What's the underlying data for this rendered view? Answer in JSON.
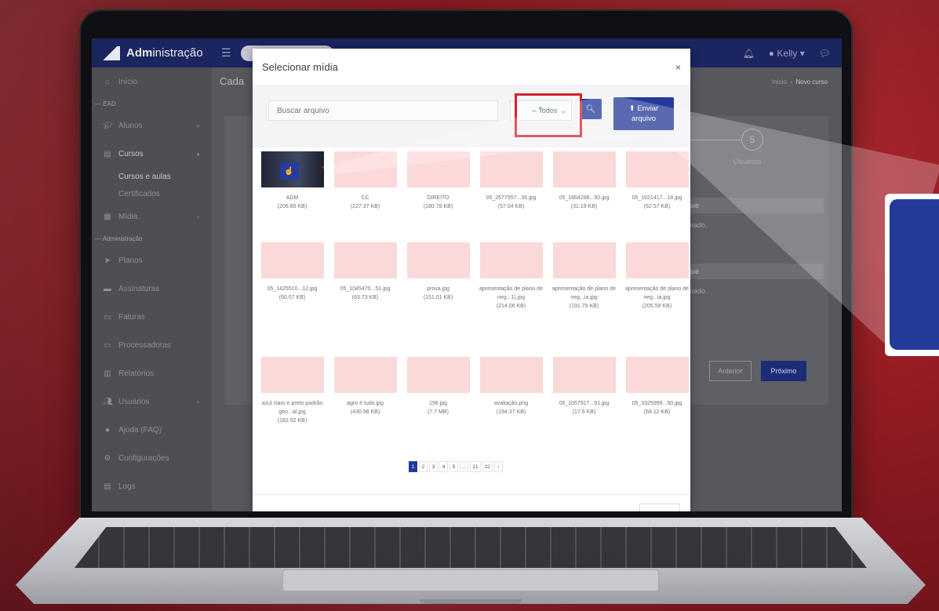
{
  "app": {
    "brand_bold": "Adm",
    "brand_rest": "inistração",
    "user_label": "Kelly"
  },
  "sidebar": {
    "items": [
      {
        "label": "Início",
        "icon": "home-icon"
      },
      {
        "section": "EAD"
      },
      {
        "label": "Alunos",
        "icon": "graduation-cap-icon",
        "chevron": true
      },
      {
        "label": "Cursos",
        "icon": "book-icon",
        "chevron": true,
        "active": true
      },
      {
        "sub": "Cursos e aulas",
        "active": true
      },
      {
        "sub": "Certificados"
      },
      {
        "label": "Mídia",
        "icon": "images-icon",
        "chevron": true
      },
      {
        "section": "Administração"
      },
      {
        "label": "Planos",
        "icon": "send-icon"
      },
      {
        "label": "Assinaturas",
        "icon": "wallet-icon"
      },
      {
        "label": "Faturas",
        "icon": "invoice-icon"
      },
      {
        "label": "Processadoras",
        "icon": "credit-card-icon"
      },
      {
        "label": "Relatórios",
        "icon": "chart-icon"
      },
      {
        "label": "Usuários",
        "icon": "users-icon",
        "chevron": true
      },
      {
        "label": "Ajuda (FAQ)",
        "icon": "help-icon"
      },
      {
        "label": "Configurações",
        "icon": "gears-icon"
      },
      {
        "label": "Logs",
        "icon": "logs-icon"
      }
    ]
  },
  "page": {
    "title": "Cada",
    "breadcrumb_home": "Início",
    "breadcrumb_current": "Novo curso",
    "stat_value": "5",
    "stat_label": "Usuários",
    "field1": "que",
    "field1_note": "onado.",
    "field2": "que",
    "field2_note": "onado.",
    "prev_label": "Anterior",
    "next_label": "Próximo"
  },
  "modal": {
    "title": "Selecionar mídia",
    "close": "×",
    "search_placeholder": "Buscar arquivo",
    "filter_value": "-- Todos",
    "upload_label_line1": "Enviar",
    "upload_label_line2": "arquivo",
    "media": [
      {
        "name": "ADM",
        "size": "(206.65 KB)",
        "thumb": "video"
      },
      {
        "name": "CC",
        "size": "(227.37 KB)"
      },
      {
        "name": "DIREITO",
        "size": "(180.78 KB)"
      },
      {
        "name": "05_2677957...36.jpg",
        "size": "(57.04 KB)"
      },
      {
        "name": "05_1864298...50.jpg",
        "size": "(31.19 KB)"
      },
      {
        "name": "05_1621417...18.jpg",
        "size": "(62.57 KB)"
      },
      {
        "name": "05_1425510...12.jpg",
        "size": "(60.07 KB)"
      },
      {
        "name": "05_1045470...51.jpg",
        "size": "(63.73 KB)"
      },
      {
        "name": "prova.jpg",
        "size": "(151.01 KB)"
      },
      {
        "name": "apresentação de plano de neg...1).jpg",
        "size": "(214.06 KB)"
      },
      {
        "name": "apresentação de plano de neg...ia.jpg",
        "size": "(191.79 KB)"
      },
      {
        "name": "apresentação de plano de neg...ia.jpg",
        "size": "(205.59 KB)"
      },
      {
        "name": "azul claro e preto padrão geo...al.jpg",
        "size": "(182.52 KB)"
      },
      {
        "name": "agro é tudo.jpg",
        "size": "(430.98 KB)"
      },
      {
        "name": "196.jpg",
        "size": "(7.7 MB)"
      },
      {
        "name": "avaliação.png",
        "size": "(194.37 KB)"
      },
      {
        "name": "05_1057917...91.jpg",
        "size": "(17.5 KB)"
      },
      {
        "name": "05_3325999...50.jpg",
        "size": "(68.12 KB)"
      }
    ],
    "pagination": [
      "1",
      "2",
      "3",
      "4",
      "5",
      "...",
      "21",
      "22",
      "›"
    ],
    "current_page": "1"
  },
  "colors": {
    "brand_blue": "#233a9a",
    "highlight_red": "#d1242f",
    "background_red": "#8d1a22"
  }
}
